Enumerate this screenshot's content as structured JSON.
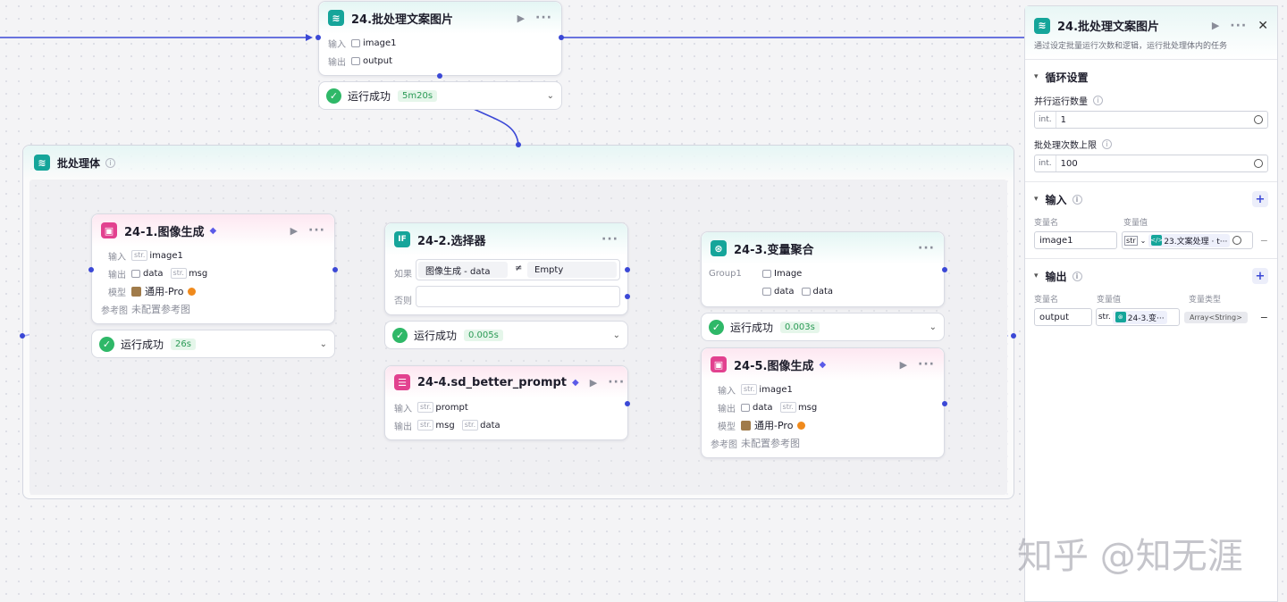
{
  "top_node": {
    "title": "24.批处理文案图片",
    "input_label": "输入",
    "input_var": "image1",
    "output_label": "输出",
    "output_var": "output",
    "status": "运行成功",
    "time": "5m20s"
  },
  "group": {
    "title": "批处理体"
  },
  "node1": {
    "title": "24-1.图像生成",
    "input_label": "输入",
    "in_type": "str.",
    "in_var": "image1",
    "output_label": "输出",
    "out1": "data",
    "out2_type": "str.",
    "out2": "msg",
    "model_label": "模型",
    "model": "通用-Pro",
    "ref_label": "参考图",
    "ref_value": "未配置参考图",
    "status": "运行成功",
    "time": "26s"
  },
  "node2": {
    "title": "24-2.选择器",
    "icon": "IF",
    "if_label": "如果",
    "else_label": "否则",
    "cond_left": "图像生成  -  data",
    "op": "≠",
    "cond_right": "Empty",
    "status": "运行成功",
    "time": "0.005s"
  },
  "node3": {
    "title": "24-3.变量聚合",
    "group_label": "Group1",
    "item1": "Image",
    "item2": "data",
    "item3": "data",
    "status": "运行成功",
    "time": "0.003s"
  },
  "node4": {
    "title": "24-4.sd_better_prompt",
    "input_label": "输入",
    "in_type": "str.",
    "in_var": "prompt",
    "output_label": "输出",
    "out1_type": "str.",
    "out1": "msg",
    "out2_type": "str.",
    "out2": "data"
  },
  "node5": {
    "title": "24-5.图像生成",
    "input_label": "输入",
    "in_type": "str.",
    "in_var": "image1",
    "output_label": "输出",
    "out1": "data",
    "out2_type": "str.",
    "out2": "msg",
    "model_label": "模型",
    "model": "通用-Pro",
    "ref_label": "参考图",
    "ref_value": "未配置参考图"
  },
  "panel": {
    "title": "24.批处理文案图片",
    "desc": "通过设定批量运行次数和逻辑，运行批处理体内的任务",
    "loop_section": "循环设置",
    "parallel_label": "并行运行数量",
    "parallel_pre": "int.",
    "parallel_value": "1",
    "limit_label": "批处理次数上限",
    "limit_pre": "int.",
    "limit_value": "100",
    "input_section": "输入",
    "col_var_name": "变量名",
    "col_var_value": "变量值",
    "input_var": "image1",
    "input_type_short": "str",
    "input_ref": "23.文案处理 · t···",
    "output_section": "输出",
    "col_var_type": "变量类型",
    "output_var": "output",
    "output_type_short": "str.",
    "output_ref": "24-3.变···",
    "output_type": "Array<String>"
  },
  "watermark": "知乎 @知无涯"
}
